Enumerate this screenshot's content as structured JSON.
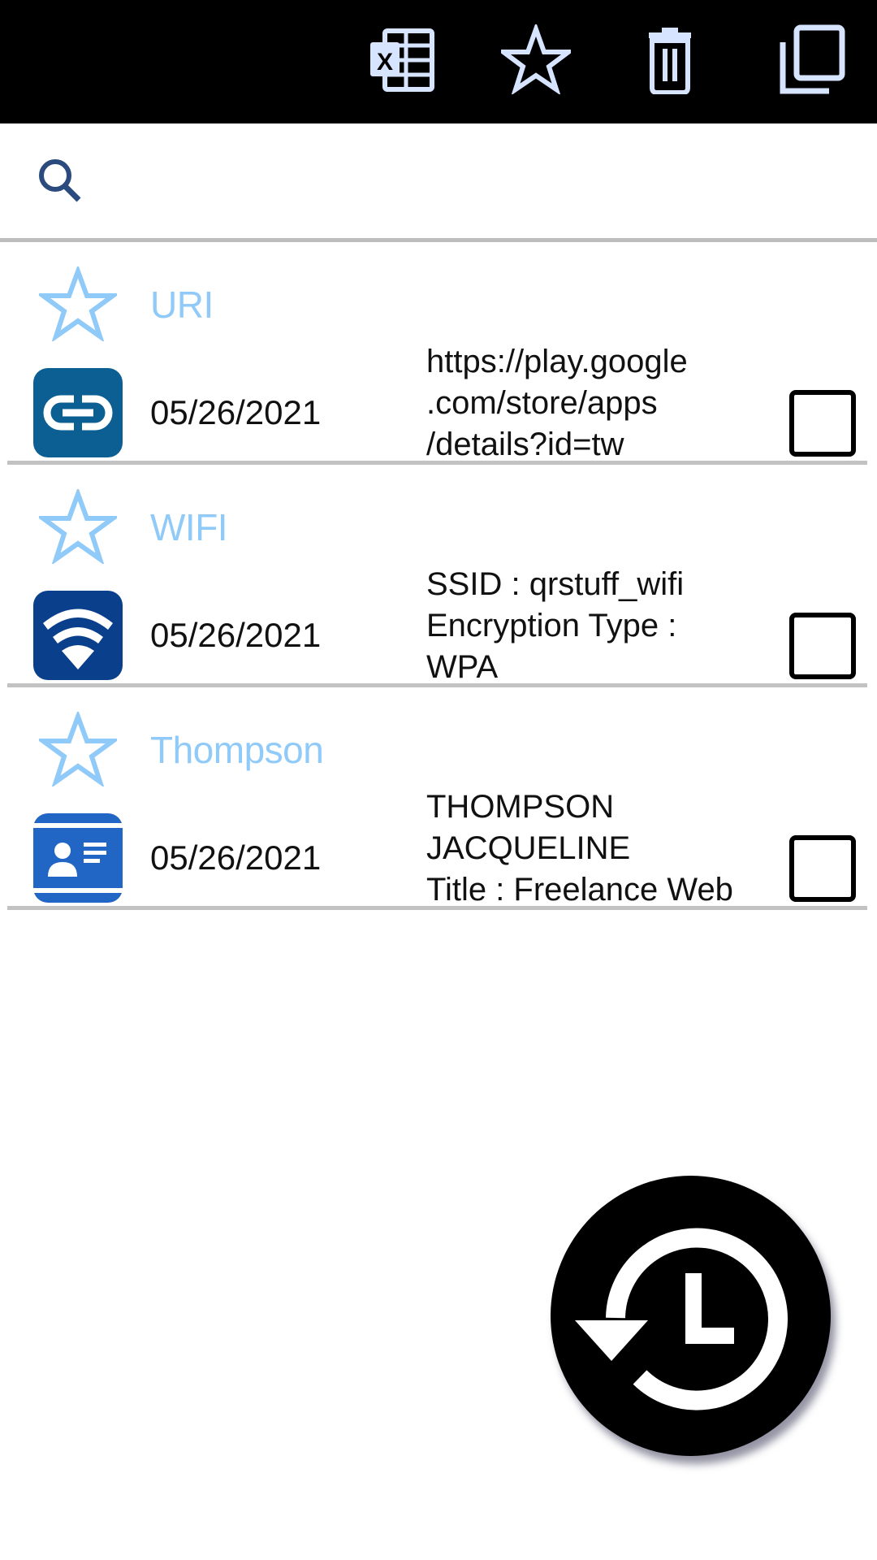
{
  "toolbar": {
    "icon_color": "#d6e4ff",
    "actions": [
      {
        "name": "export-excel",
        "icon": "excel-icon"
      },
      {
        "name": "favorites",
        "icon": "star-outline-icon"
      },
      {
        "name": "delete",
        "icon": "trash-icon"
      },
      {
        "name": "select-all",
        "icon": "copy-icon"
      }
    ]
  },
  "search": {
    "icon": "search-icon",
    "value": "",
    "placeholder": ""
  },
  "colors": {
    "title": "#90caf9",
    "star": "#90caf9",
    "uri_icon_bg": "#0b5f92",
    "wifi_icon_bg": "#0a3f8c",
    "contact_icon_bg": "#2166c4"
  },
  "history": [
    {
      "title": "URI",
      "type_icon": "link-icon",
      "date": "05/26/2021",
      "content": "https://play.google\n.com/store/apps\n/details?id=tw",
      "favorite": false,
      "checked": false
    },
    {
      "title": "WIFI",
      "type_icon": "wifi-icon",
      "date": "05/26/2021",
      "content": "SSID : qrstuff_wifi\nEncryption Type :\nWPA",
      "favorite": false,
      "checked": false
    },
    {
      "title": "Thompson",
      "type_icon": "contact-card-icon",
      "date": "05/26/2021",
      "content": "THOMPSON\nJACQUELINE\nTitle : Freelance Web",
      "favorite": false,
      "checked": false
    }
  ],
  "fab": {
    "icon": "history-icon"
  }
}
